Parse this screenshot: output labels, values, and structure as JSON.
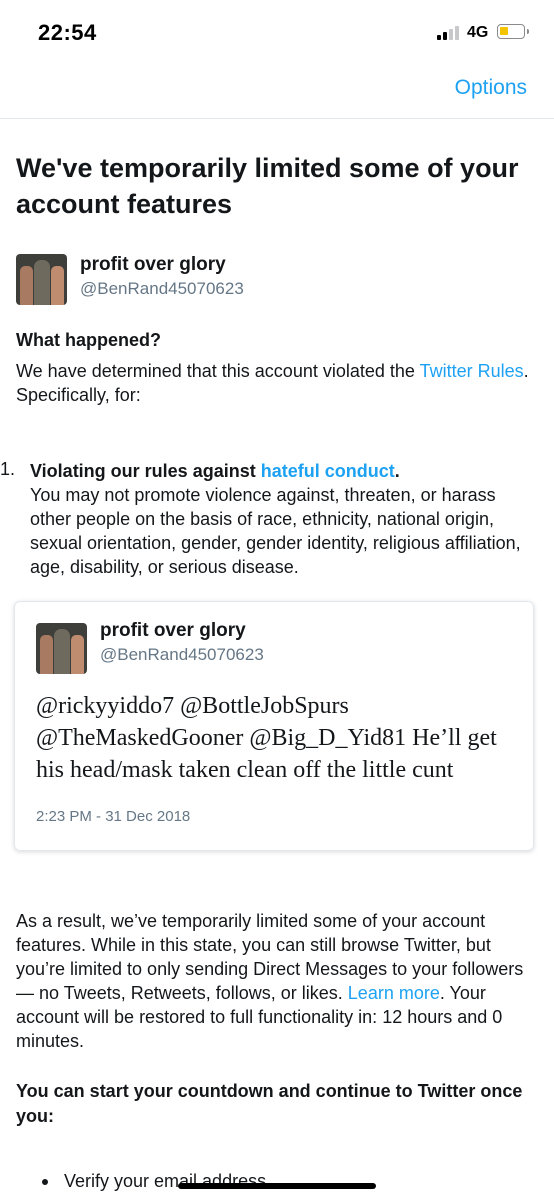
{
  "status_bar": {
    "time": "22:54",
    "network": "4G"
  },
  "nav": {
    "options_label": "Options"
  },
  "headline": "We've temporarily limited some of your account features",
  "account": {
    "name": "profit over glory",
    "handle": "@BenRand45070623"
  },
  "what_happened": {
    "title": "What happened?",
    "text_before": "We have determined that this account violated the ",
    "link": "Twitter Rules",
    "text_after": ". Specifically, for:"
  },
  "violations": [
    {
      "number": "1.",
      "title_before": "Violating our rules against ",
      "title_link": "hateful conduct",
      "title_after": ".",
      "description": "You may not promote violence against, threaten, or harass other people on the basis of race, ethnicity, national origin, sexual orientation, gender, gender identity, religious affiliation, age, disability, or serious disease."
    }
  ],
  "tweet": {
    "name": "profit over glory",
    "handle": "@BenRand45070623",
    "text": "@rickyyiddo7 @BottleJobSpurs @TheMaskedGooner @Big_D_Yid81 He’ll get his head/mask taken clean off the little cunt",
    "timestamp": "2:23 PM - 31 Dec 2018"
  },
  "result": {
    "text_before": "As a result, we’ve temporarily limited some of your account features. While in this state, you can still browse Twitter, but you’re limited to only sending Direct Messages to your followers — no Tweets, Retweets, follows, or likes. ",
    "link": "Learn more",
    "text_after": ". Your account will be restored to full functionality in: 12 hours and 0 minutes."
  },
  "countdown": {
    "title": "You can start your countdown and continue to Twitter once you:",
    "items": [
      "Verify your email address"
    ]
  },
  "colors": {
    "link": "#1da1f2",
    "text": "#14171a",
    "muted": "#657786",
    "battery": "#f5c400"
  }
}
